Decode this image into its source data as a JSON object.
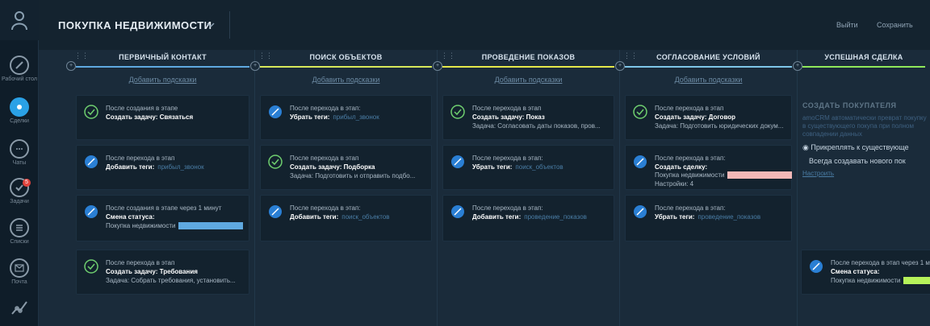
{
  "nav": {
    "items": [
      {
        "label": "Рабочий стол",
        "icon": "dashboard-icon"
      },
      {
        "label": "Сделки",
        "icon": "deals-icon"
      },
      {
        "label": "Чаты",
        "icon": "chat-icon"
      },
      {
        "label": "Задачи",
        "icon": "tasks-icon",
        "badge": "5"
      },
      {
        "label": "Списки",
        "icon": "lists-icon"
      },
      {
        "label": "Почта",
        "icon": "mail-icon"
      },
      {
        "label": "",
        "icon": "stats-icon"
      }
    ]
  },
  "topbar": {
    "title": "ПОКУПКА НЕДВИЖИМОСТИ",
    "cancel": "Выйти",
    "save": "Сохранить"
  },
  "stages": [
    {
      "name": "ПЕРВИЧНЫЙ КОНТАКТ",
      "add": "Добавить подсказки",
      "color": "#5fa9e0"
    },
    {
      "name": "ПОИСК ОБЪЕКТОВ",
      "add": "Добавить подсказки",
      "color": "#d7e85a"
    },
    {
      "name": "ПРОВЕДЕНИЕ ПОКАЗОВ",
      "add": "Добавить подсказки",
      "color": "#e5e84a"
    },
    {
      "name": "СОГЛАСОВАНИЕ УСЛОВИЙ",
      "add": "Добавить подсказки",
      "color": "#7ec6e8"
    },
    {
      "name": "УСПЕШНАЯ СДЕЛКА",
      "add": "",
      "color": "#8fe85a"
    }
  ],
  "cards": {
    "c1r1": {
      "t1": "После создания в этапе",
      "t2": "Создать задачу: Связаться",
      "v": "",
      "t3": ""
    },
    "c1r2": {
      "t1": "После перехода в этап",
      "t2": "Добавить теги:",
      "v": "прибыл_звонок",
      "t3": ""
    },
    "c1r3": {
      "t1": "После создания в этапе через 1 минут",
      "t2": "Смена статуса:",
      "v": "",
      "t3": "Покупка недвижимости"
    },
    "c1r4": {
      "t1": "После перехода в этап",
      "t2": "Создать задачу: Требования",
      "v": "",
      "t3": "Задача: Собрать требования, установить..."
    },
    "c2r1": {
      "t1": "После перехода в этап:",
      "t2": "Убрать теги:",
      "v": "прибыл_звонок",
      "t3": ""
    },
    "c2r2": {
      "t1": "После перехода в этап",
      "t2": "Создать задачу: Подборка",
      "v": "",
      "t3": "Задача: Подготовить и отправить подбо..."
    },
    "c2r3": {
      "t1": "После перехода в этап:",
      "t2": "Добавить теги:",
      "v": "поиск_объектов",
      "t3": ""
    },
    "c3r1": {
      "t1": "После перехода в этап",
      "t2": "Создать задачу: Показ",
      "v": "",
      "t3": "Задача: Согласовать даты показов, пров..."
    },
    "c3r2": {
      "t1": "После перехода в этап:",
      "t2": "Убрать теги:",
      "v": "поиск_объектов",
      "t3": ""
    },
    "c3r3": {
      "t1": "После перехода в этап:",
      "t2": "Добавить теги:",
      "v": "проведение_показов",
      "t3": ""
    },
    "c4r1": {
      "t1": "После перехода в этап",
      "t2": "Создать задачу: Договор",
      "v": "",
      "t3": "Задача: Подготовить юридических докум..."
    },
    "c4r2": {
      "t1": "После перехода в этап:",
      "t2": "Создать сделку:",
      "v": "",
      "t3": "Покупка недвижимости",
      "t4": "Настройки: 4"
    },
    "c4r3": {
      "t1": "После перехода в этап:",
      "t2": "Убрать теги:",
      "v": "проведение_показов",
      "t3": ""
    },
    "c5r4": {
      "t1": "После перехода в этап через 1 ми",
      "t2": "Смена статуса:",
      "v": "",
      "t3": "Покупка недвижимости"
    }
  },
  "right_panel": {
    "title": "СОЗДАТЬ ПОКУПАТЕЛЯ",
    "text": "amoCRM автоматически преврат покупку в существующего покупа при полном совпадении данных",
    "opt1": "Прикреплять к существующе",
    "opt2": "Всегда создавать нового пок",
    "link": "Настроить"
  }
}
